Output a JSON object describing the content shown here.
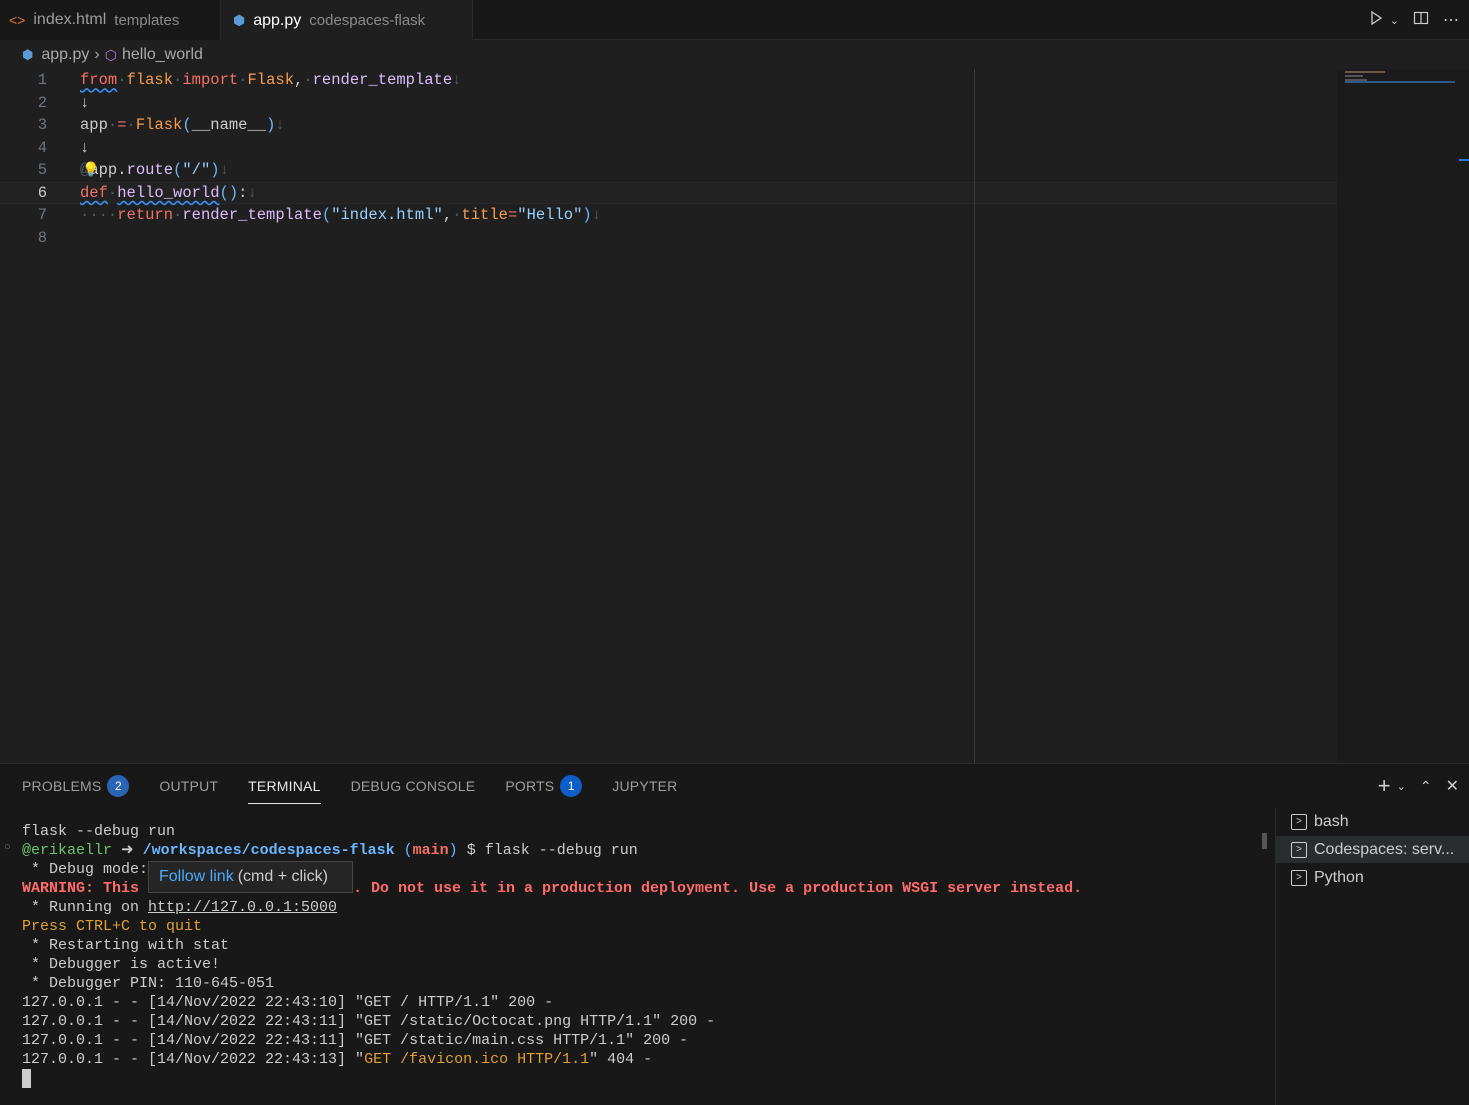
{
  "tabs": [
    {
      "icon": "html-icon",
      "name": "index.html",
      "desc": "templates"
    },
    {
      "icon": "python-icon",
      "name": "app.py",
      "desc": "codespaces-flask"
    }
  ],
  "breadcrumb": {
    "file": "app.py",
    "symbol": "hello_world"
  },
  "editor": {
    "line_numbers": [
      "1",
      "2",
      "3",
      "4",
      "5",
      "6",
      "7",
      "8"
    ],
    "lines": [
      {
        "parts": [
          [
            "kw",
            "from"
          ],
          [
            "ws",
            "·"
          ],
          [
            "mod",
            "flask"
          ],
          [
            "ws",
            "·"
          ],
          [
            "kw",
            "import"
          ],
          [
            "ws",
            "·"
          ],
          [
            "mod",
            "Flask"
          ],
          [
            "",
            ","
          ],
          [
            "ws",
            "·"
          ],
          [
            "fn",
            "render_template"
          ],
          [
            "ws",
            "↓"
          ]
        ]
      },
      {
        "parts": [
          [
            "",
            "↓"
          ]
        ]
      },
      {
        "parts": [
          [
            "",
            "app"
          ],
          [
            "ws",
            "·"
          ],
          [
            "kw",
            "="
          ],
          [
            "ws",
            "·"
          ],
          [
            "mod",
            "Flask"
          ],
          [
            "par",
            "("
          ],
          [
            "",
            "__name__"
          ],
          [
            "par",
            ")"
          ],
          [
            "ws",
            "↓"
          ]
        ]
      },
      {
        "parts": [
          [
            "",
            "↓"
          ]
        ]
      },
      {
        "parts": [
          [
            "ws",
            "@"
          ],
          [
            "",
            "app"
          ],
          [
            "",
            "."
          ],
          [
            "fn",
            "route"
          ],
          [
            "par",
            "("
          ],
          [
            "str",
            "\"/\""
          ],
          [
            "par",
            ")"
          ],
          [
            "ws",
            "↓"
          ]
        ]
      },
      {
        "parts": [
          [
            "kw",
            "def"
          ],
          [
            "ws",
            "·"
          ],
          [
            "fn",
            "hello_world"
          ],
          [
            "par",
            "()"
          ],
          [
            "",
            ":"
          ],
          [
            "ws",
            "↓"
          ]
        ]
      },
      {
        "parts": [
          [
            "ws",
            "····"
          ],
          [
            "kw",
            "return"
          ],
          [
            "ws",
            "·"
          ],
          [
            "fn",
            "render_template"
          ],
          [
            "par",
            "("
          ],
          [
            "str",
            "\"index.html\""
          ],
          [
            "",
            ","
          ],
          [
            "ws",
            "·"
          ],
          [
            "mod",
            "title"
          ],
          [
            "kw",
            "="
          ],
          [
            "str",
            "\"Hello\""
          ],
          [
            "par",
            ")"
          ],
          [
            "ws",
            "↓"
          ]
        ]
      },
      {
        "parts": []
      }
    ]
  },
  "panel": {
    "tabs": [
      {
        "label": "PROBLEMS",
        "badge": "2"
      },
      {
        "label": "OUTPUT"
      },
      {
        "label": "TERMINAL"
      },
      {
        "label": "DEBUG CONSOLE"
      },
      {
        "label": "PORTS",
        "badge": "1"
      },
      {
        "label": "JUPYTER"
      }
    ]
  },
  "terminal": {
    "l1": "flask --debug run",
    "prompt_user": "@erikaellr",
    "prompt_arrow": " ➜ ",
    "prompt_path": "/workspaces/codespaces-flask",
    "prompt_branch_open": " (",
    "prompt_branch": "main",
    "prompt_branch_close": ")",
    "prompt_cmd": " $ flask --debug run",
    "debug_mode": " * Debug mode:",
    "warn_start": "WARNING: This",
    "warn_end": ". Do not use it in a production deployment. Use a production WSGI server instead.",
    "running_prefix": " * Running on ",
    "running_url": "http://127.0.0.1:5000",
    "quit": "Press CTRL+C to quit",
    "restart": " * Restarting with stat",
    "debugger_active": " * Debugger is active!",
    "debugger_pin": " * Debugger PIN: 110-645-051",
    "log1": "127.0.0.1 - - [14/Nov/2022 22:43:10] \"GET / HTTP/1.1\" 200 -",
    "log2": "127.0.0.1 - - [14/Nov/2022 22:43:11] \"GET /static/Octocat.png HTTP/1.1\" 200 -",
    "log3": "127.0.0.1 - - [14/Nov/2022 22:43:11] \"GET /static/main.css HTTP/1.1\" 200 -",
    "log4_pre": "127.0.0.1 - - [14/Nov/2022 22:43:13] \"",
    "log4_mid": "GET /favicon.ico HTTP/1.1",
    "log4_post": "\" 404 -",
    "tooltip_link": "Follow link",
    "tooltip_hint": "(cmd + click)"
  },
  "terminal_list": [
    "bash",
    "Codespaces: serv...",
    "Python"
  ]
}
